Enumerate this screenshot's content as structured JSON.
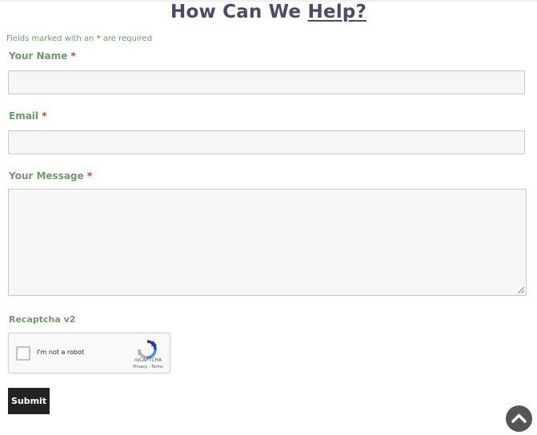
{
  "heading": {
    "text": "How Can We ",
    "link": "Help?"
  },
  "required_note": {
    "prefix": "Fields marked with an ",
    "star": "*",
    "suffix": " are required"
  },
  "form": {
    "name_label": "Your Name",
    "email_label": "Email",
    "message_label": "Your Message",
    "required_star": "*",
    "name_value": "",
    "email_value": "",
    "message_value": ""
  },
  "recaptcha": {
    "label": "Recaptcha v2",
    "checkbox_text": "I'm not a robot",
    "brand": "reCAPTCHA",
    "terms": "Privacy - Terms"
  },
  "submit_label": "Submit",
  "icons": {
    "scroll_top": "chevron-up-icon",
    "captcha_logo": "recaptcha-logo-icon"
  },
  "colors": {
    "heading": "#4a4b6a",
    "label": "#6e9a6a",
    "required": "#e0312f",
    "button": "#222222"
  }
}
